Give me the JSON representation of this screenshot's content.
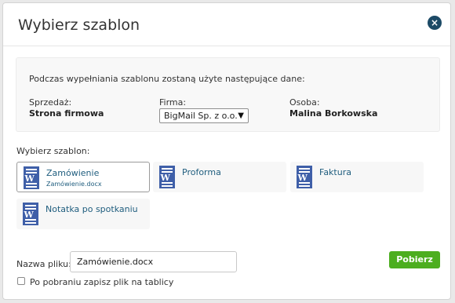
{
  "dialog": {
    "title": "Wybierz szablon",
    "close_glyph": "×"
  },
  "info": {
    "intro": "Podczas wypełniania szablonu zostaną użyte następujące dane:",
    "sales_label": "Sprzedaż:",
    "sales_value": "Strona firmowa",
    "company_label": "Firma:",
    "company_value": "BigMail Sp. z o.o.",
    "person_label": "Osoba:",
    "person_value": "Malina Borkowska"
  },
  "templates": {
    "label": "Wybierz szablon:",
    "items": [
      {
        "name": "Zamówienie",
        "file": "Zamówienie.docx",
        "selected": true,
        "icon": "word-doc-icon"
      },
      {
        "name": "Proforma",
        "file": "",
        "selected": false,
        "icon": "word-doc-icon"
      },
      {
        "name": "Faktura",
        "file": "",
        "selected": false,
        "icon": "word-doc-icon"
      },
      {
        "name": "Notatka po spotkaniu",
        "file": "",
        "selected": false,
        "icon": "word-doc-icon"
      }
    ]
  },
  "footer": {
    "filename_label": "Nazwa pliku:",
    "filename_value": "Zamówienie.docx",
    "download_label": "Pobierz",
    "save_checkbox_label": "Po pobraniu zapisz plik na tablicy",
    "save_checked": false
  },
  "colors": {
    "accent_green": "#4cae1f",
    "close_bg": "#1c4a66",
    "link": "#1f5d7e",
    "word_blue": "#3f5fa8"
  }
}
